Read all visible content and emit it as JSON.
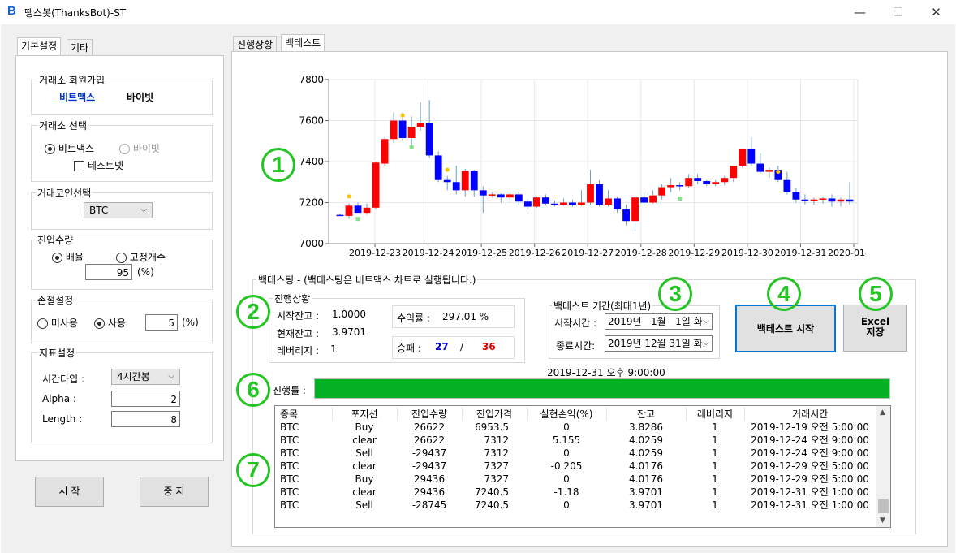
{
  "window": {
    "title": "땡스봇(ThanksBot)-ST",
    "logo": "B",
    "min": "—",
    "max": "☐",
    "close": "✕"
  },
  "left": {
    "tabs": [
      "기본설정",
      "기타"
    ],
    "signup": {
      "title": "거래소 회원가입",
      "link1": "비트맥스",
      "link2": "바이빗"
    },
    "exchange": {
      "title": "거래소 선택",
      "opt1": "비트맥스",
      "opt2": "바이빗",
      "testnet": "테스트넷"
    },
    "coin": {
      "title": "거래코인선택",
      "value": "BTC"
    },
    "entry": {
      "title": "진입수량",
      "opt1": "배율",
      "opt2": "고정개수",
      "value": "95",
      "unit": "(%)"
    },
    "stoploss": {
      "title": "손절설정",
      "opt1": "미사용",
      "opt2": "사용",
      "value": "5",
      "unit": "(%)"
    },
    "indicator": {
      "title": "지표설정",
      "type_label": "시간타입 :",
      "type_value": "4시간봉",
      "alpha_label": "Alpha :",
      "alpha_value": "2",
      "length_label": "Length :",
      "length_value": "8"
    },
    "start_btn": "시 작",
    "stop_btn": "중 지"
  },
  "right": {
    "tabs": [
      "진행상황",
      "백테스트"
    ],
    "markers": [
      "1",
      "2",
      "3",
      "4",
      "5",
      "6",
      "7"
    ],
    "backtest_title": "백테스팅 - (백테스팅은 비트맥스 차트로 실행됩니다.)",
    "status": {
      "title": "진행상황",
      "start_balance_label": "시작잔고 :",
      "start_balance": "1.0000",
      "current_balance_label": "현재잔고 :",
      "current_balance": "3.9701",
      "leverage_label": "레버리지 :",
      "leverage": "1",
      "return_label": "수익률 :",
      "return_value": "297.01 %",
      "winloss_label": "승패 :",
      "wins": "27",
      "sep": "/",
      "losses": "36"
    },
    "period": {
      "title": "백테스트 기간(최대1년)",
      "start_label": "시작시간 :",
      "start_value": "2019년   1월   1일 화.",
      "end_label": "종료시간:",
      "end_value": "2019년 12월 31일 화."
    },
    "run_btn": "백테스트 시작",
    "excel_btn_line1": "Excel",
    "excel_btn_line2": "저장",
    "progress_time": "2019-12-31 오후 9:00:00",
    "progress_label": "진행률 :",
    "progress_value": 1.0,
    "table": {
      "headers": [
        "종목",
        "포지션",
        "진입수량",
        "진입가격",
        "실현손익(%)",
        "잔고",
        "레버리지",
        "거래시간"
      ],
      "rows": [
        [
          "BTC",
          "Buy",
          "26622",
          "6953.5",
          "0",
          "3.8286",
          "1",
          "2019-12-19 오전 5:00:00"
        ],
        [
          "BTC",
          "clear",
          "26622",
          "7312",
          "5.155",
          "4.0259",
          "1",
          "2019-12-24 오전 9:00:00"
        ],
        [
          "BTC",
          "Sell",
          "-29437",
          "7312",
          "0",
          "4.0259",
          "1",
          "2019-12-24 오전 9:00:00"
        ],
        [
          "BTC",
          "clear",
          "-29437",
          "7327",
          "-0.205",
          "4.0176",
          "1",
          "2019-12-29 오전 5:00:00"
        ],
        [
          "BTC",
          "Buy",
          "29436",
          "7327",
          "0",
          "4.0176",
          "1",
          "2019-12-29 오전 5:00:00"
        ],
        [
          "BTC",
          "clear",
          "29436",
          "7240.5",
          "-1.18",
          "3.9701",
          "1",
          "2019-12-31 오전 1:00:00"
        ],
        [
          "BTC",
          "Sell",
          "-28745",
          "7240.5",
          "0",
          "3.9701",
          "1",
          "2019-12-31 오전 1:00:00"
        ]
      ]
    }
  },
  "chart_data": {
    "type": "candlestick",
    "ylim": [
      7000,
      7800
    ],
    "yticks": [
      "7000",
      "7200",
      "7400",
      "7600",
      "7800"
    ],
    "xticks": [
      "2019-12-23",
      "2019-12-24",
      "2019-12-25",
      "2019-12-26",
      "2019-12-27",
      "2019-12-28",
      "2019-12-29",
      "2019-12-30",
      "2019-12-31",
      "2020-01-01"
    ],
    "colors": {
      "up": "#ff0000",
      "down": "#0000ff",
      "buy_marker": "#88e088",
      "sell_marker": "#ffc000"
    },
    "candles": [
      [
        7140,
        7145,
        7135,
        7138
      ],
      [
        7135,
        7195,
        7120,
        7185
      ],
      [
        7185,
        7200,
        7160,
        7150
      ],
      [
        7150,
        7195,
        7140,
        7175
      ],
      [
        7175,
        7400,
        7170,
        7395
      ],
      [
        7390,
        7520,
        7380,
        7510
      ],
      [
        7510,
        7640,
        7490,
        7600
      ],
      [
        7600,
        7640,
        7500,
        7515
      ],
      [
        7515,
        7620,
        7480,
        7570
      ],
      [
        7570,
        7690,
        7550,
        7590
      ],
      [
        7590,
        7700,
        7420,
        7430
      ],
      [
        7430,
        7450,
        7300,
        7310
      ],
      [
        7310,
        7330,
        7260,
        7300
      ],
      [
        7300,
        7380,
        7240,
        7260
      ],
      [
        7260,
        7365,
        7230,
        7355
      ],
      [
        7355,
        7360,
        7230,
        7260
      ],
      [
        7260,
        7280,
        7150,
        7235
      ],
      [
        7235,
        7250,
        7225,
        7240
      ],
      [
        7240,
        7245,
        7200,
        7225
      ],
      [
        7225,
        7245,
        7205,
        7240
      ],
      [
        7240,
        7250,
        7190,
        7205
      ],
      [
        7205,
        7220,
        7170,
        7180
      ],
      [
        7180,
        7230,
        7175,
        7225
      ],
      [
        7225,
        7240,
        7185,
        7195
      ],
      [
        7195,
        7210,
        7180,
        7190
      ],
      [
        7190,
        7220,
        7185,
        7200
      ],
      [
        7200,
        7215,
        7180,
        7190
      ],
      [
        7190,
        7260,
        7185,
        7200
      ],
      [
        7200,
        7360,
        7190,
        7290
      ],
      [
        7290,
        7310,
        7180,
        7190
      ],
      [
        7190,
        7260,
        7180,
        7220
      ],
      [
        7220,
        7230,
        7150,
        7170
      ],
      [
        7170,
        7190,
        7090,
        7110
      ],
      [
        7110,
        7230,
        7060,
        7225
      ],
      [
        7225,
        7250,
        7185,
        7200
      ],
      [
        7200,
        7260,
        7195,
        7235
      ],
      [
        7235,
        7290,
        7215,
        7275
      ],
      [
        7275,
        7320,
        7250,
        7285
      ],
      [
        7285,
        7300,
        7260,
        7280
      ],
      [
        7280,
        7340,
        7270,
        7320
      ],
      [
        7320,
        7340,
        7290,
        7305
      ],
      [
        7305,
        7310,
        7280,
        7290
      ],
      [
        7290,
        7310,
        7280,
        7300
      ],
      [
        7300,
        7330,
        7285,
        7320
      ],
      [
        7320,
        7380,
        7300,
        7380
      ],
      [
        7380,
        7460,
        7370,
        7460
      ],
      [
        7460,
        7520,
        7380,
        7390
      ],
      [
        7390,
        7440,
        7340,
        7350
      ],
      [
        7350,
        7370,
        7320,
        7360
      ],
      [
        7360,
        7380,
        7300,
        7310
      ],
      [
        7310,
        7350,
        7240,
        7250
      ],
      [
        7250,
        7270,
        7200,
        7215
      ],
      [
        7215,
        7240,
        7190,
        7210
      ],
      [
        7210,
        7225,
        7190,
        7215
      ],
      [
        7215,
        7230,
        7195,
        7220
      ],
      [
        7220,
        7240,
        7180,
        7205
      ],
      [
        7205,
        7225,
        7180,
        7215
      ],
      [
        7215,
        7300,
        7190,
        7205
      ]
    ],
    "markers": [
      {
        "i": 1,
        "y": 7230,
        "kind": "sell"
      },
      {
        "i": 2,
        "y": 7120,
        "kind": "buy"
      },
      {
        "i": 7,
        "y": 7625,
        "kind": "sell"
      },
      {
        "i": 8,
        "y": 7470,
        "kind": "buy"
      },
      {
        "i": 12,
        "y": 7360,
        "kind": "sell"
      },
      {
        "i": 38,
        "y": 7220,
        "kind": "buy"
      },
      {
        "i": 49,
        "y": 7350,
        "kind": "sell"
      }
    ]
  }
}
